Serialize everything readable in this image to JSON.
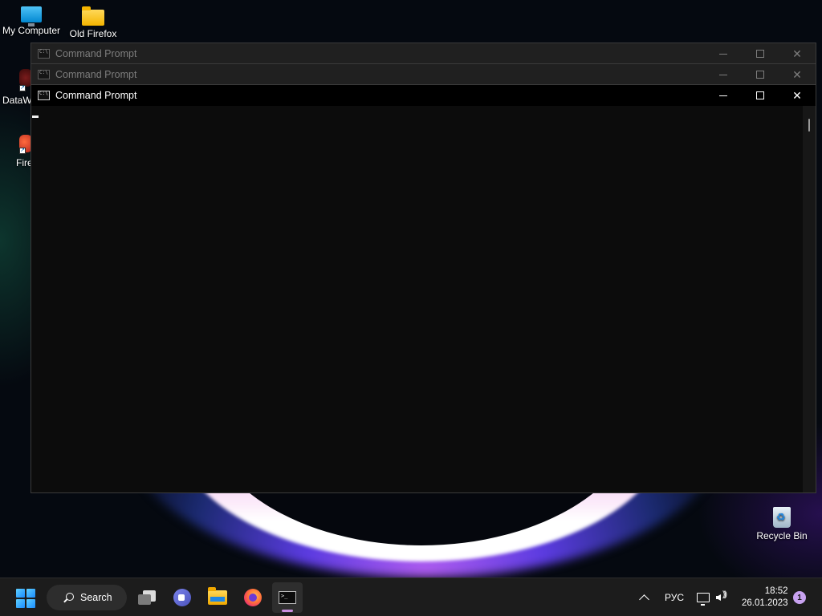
{
  "desktop": {
    "icons": [
      {
        "label": "My Computer"
      },
      {
        "label": "Old Firefox"
      },
      {
        "label": "DataW"
      },
      {
        "label": "Fire"
      },
      {
        "label": "Recycle Bin"
      }
    ]
  },
  "windows": [
    {
      "title": "Command Prompt",
      "state": "inactive"
    },
    {
      "title": "Command Prompt",
      "state": "inactive"
    },
    {
      "title": "Command Prompt",
      "state": "active"
    }
  ],
  "controls": {
    "minimize": "—",
    "maximize": "☐",
    "close": "✕"
  },
  "taskbar": {
    "search_label": "Search",
    "apps": [
      "task-view",
      "meet",
      "file-explorer",
      "firefox",
      "command-prompt"
    ],
    "tray": {
      "language": "РУС",
      "time": "18:52",
      "date": "26.01.2023",
      "notification_count": "1"
    }
  },
  "colors": {
    "accent": "#c98fe0",
    "console_bg": "#0c0c0c",
    "taskbar_bg": "#1c1c1c"
  }
}
